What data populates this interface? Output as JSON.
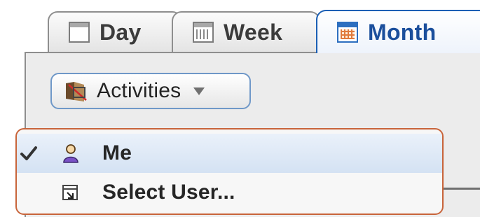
{
  "tabs": {
    "day": {
      "label": "Day"
    },
    "week": {
      "label": "Week"
    },
    "month": {
      "label": "Month",
      "selected": true
    }
  },
  "activities_button": {
    "label": "Activities"
  },
  "menu": {
    "items": [
      {
        "label": "Me",
        "checked": true,
        "highlighted": true,
        "icon": "user-icon"
      },
      {
        "label": "Select User...",
        "checked": false,
        "icon": "select-user-icon"
      }
    ]
  },
  "colors": {
    "selected_tab_border": "#1b5fb4",
    "menu_border": "#c8643a",
    "button_border": "#6f98c8"
  }
}
